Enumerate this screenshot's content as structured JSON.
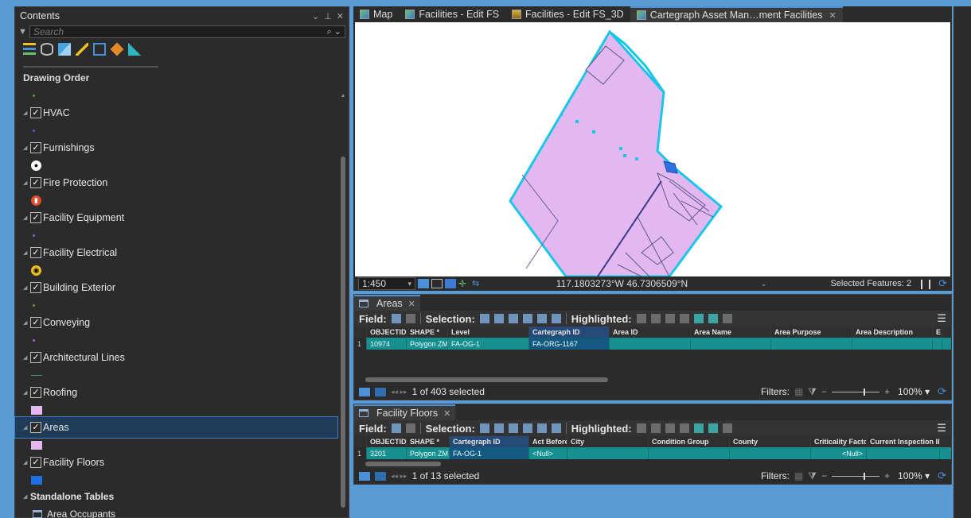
{
  "contents": {
    "title": "Contents",
    "search_placeholder": "Search",
    "section_label": "Drawing Order",
    "layers": [
      {
        "name": "HVAC",
        "checked": true,
        "symbol": "dot",
        "color": "#6a4fd6"
      },
      {
        "name": "Furnishings",
        "checked": true,
        "symbol": "round-white",
        "color": "#ffffff"
      },
      {
        "name": "Fire Protection",
        "checked": true,
        "symbol": "round-red",
        "color": "#e04b2a"
      },
      {
        "name": "Facility Equipment",
        "checked": true,
        "symbol": "dot",
        "color": "#8a5fd6"
      },
      {
        "name": "Facility Electrical",
        "checked": true,
        "symbol": "round-yellow",
        "color": "#f0c020"
      },
      {
        "name": "Building Exterior",
        "checked": true,
        "symbol": "dot",
        "color": "#5fa03f"
      },
      {
        "name": "Conveying",
        "checked": true,
        "symbol": "dot",
        "color": "#b05fd6"
      },
      {
        "name": "Architectural Lines",
        "checked": true,
        "symbol": "line",
        "color": "#4f8f6f"
      },
      {
        "name": "Roofing",
        "checked": true,
        "symbol": "swatch",
        "color": "#e3b7f0"
      },
      {
        "name": "Areas",
        "checked": true,
        "symbol": "swatch",
        "color": "#e3b7f0",
        "selected": true
      },
      {
        "name": "Facility Floors",
        "checked": true,
        "symbol": "swatch",
        "color": "#1f6fe0"
      }
    ],
    "standalone_label": "Standalone Tables",
    "tables": [
      "Area Occupants"
    ]
  },
  "map_tabs": [
    {
      "label": "Map",
      "active": false
    },
    {
      "label": "Facilities - Edit FS",
      "active": false
    },
    {
      "label": "Facilities - Edit FS_3D",
      "active": false
    },
    {
      "label": "Cartegraph Asset Man…ment Facilities",
      "active": true
    }
  ],
  "map_status": {
    "scale": "1:450",
    "coordinates": "117.1803273°W 46.7306509°N",
    "selected_features": "Selected Features: 2"
  },
  "areas_table": {
    "tab_label": "Areas",
    "field_label": "Field:",
    "selection_label": "Selection:",
    "highlighted_label": "Highlighted:",
    "columns": [
      "OBJECTID *",
      "SHAPE *",
      "Level",
      "Cartegraph ID",
      "Area ID",
      "Area Name",
      "Area Purpose",
      "Area Description",
      "E"
    ],
    "rows": [
      [
        "1",
        "10974",
        "Polygon ZM",
        "FA-OG-1",
        "FA-ORG-1167",
        "",
        "",
        "",
        "",
        ""
      ]
    ],
    "footer_text": "1 of 403 selected",
    "filters_label": "Filters:",
    "zoom": "100%"
  },
  "floors_table": {
    "tab_label": "Facility Floors",
    "field_label": "Field:",
    "selection_label": "Selection:",
    "highlighted_label": "Highlighted:",
    "columns": [
      "OBJECTID *",
      "SHAPE *",
      "Cartegraph ID",
      "Act Before",
      "City",
      "Condition Group",
      "County",
      "Criticality Factor",
      "Current Inspection ID"
    ],
    "rows": [
      [
        "1",
        "3201",
        "Polygon ZM",
        "FA-OG-1",
        "<Null>",
        "",
        "",
        "",
        "<Null>",
        ""
      ]
    ],
    "footer_text": "1 of 13 selected",
    "filters_label": "Filters:",
    "zoom": "100%"
  },
  "colors": {
    "desktop": "#5b9bd5",
    "pane": "#2b2b2b",
    "selected_row": "#178f8f",
    "polygon_fill": "#e3b7f0",
    "polygon_outline": "#19c6e6",
    "accent": "#4a90d9"
  }
}
